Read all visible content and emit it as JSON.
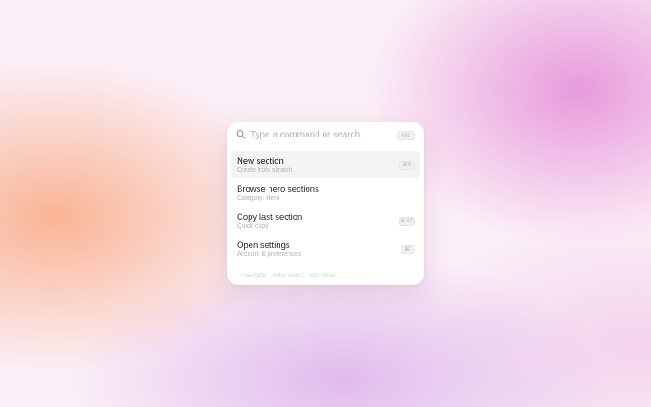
{
  "search": {
    "placeholder": "Type a command or search...",
    "esc_hint": "esc"
  },
  "items": [
    {
      "title": "New section",
      "subtitle": "Create from scratch",
      "shortcut": "⌘N"
    },
    {
      "title": "Browse hero sections",
      "subtitle": "Category: Hero",
      "shortcut": ""
    },
    {
      "title": "Copy last section",
      "subtitle": "Quick copy",
      "shortcut": "⌘⇧C"
    },
    {
      "title": "Open settings",
      "subtitle": "Account & preferences",
      "shortcut": "⌘,"
    }
  ],
  "footer": {
    "navigate": "↑↓ navigate",
    "select": "enter select",
    "close": "esc close"
  }
}
